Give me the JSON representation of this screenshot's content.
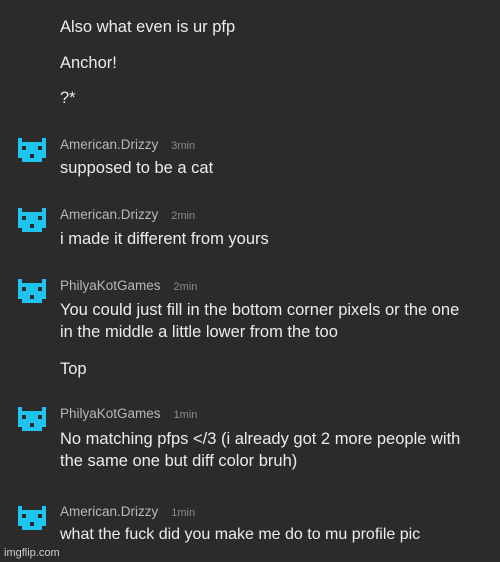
{
  "messages": [
    {
      "text": "Also what even is ur pfp"
    },
    {
      "text": "Anchor!"
    },
    {
      "text": "?*"
    },
    {
      "user": "American.Drizzy",
      "time": "3min",
      "text": "supposed to be a cat"
    },
    {
      "user": "American.Drizzy",
      "time": "2min",
      "text": "i made it different from yours"
    },
    {
      "user": "PhilyaKotGames",
      "time": "2min",
      "text": "You could just fill in the bottom corner pixels or the one in the middle a little lower from the too"
    },
    {
      "text": "Top"
    },
    {
      "user": "PhilyaKotGames",
      "time": "1min",
      "text": "No matching pfps </3 (i already got 2 more people with the same one but diff color bruh)"
    },
    {
      "user": "American.Drizzy",
      "time": "1min",
      "text": "what the fuck did you make me do to mu profile pic"
    }
  ],
  "avatar_color": "#1ec3f0",
  "watermark": "imgflip.com",
  "icons": {
    "avatar": "pixel-cat-icon"
  }
}
